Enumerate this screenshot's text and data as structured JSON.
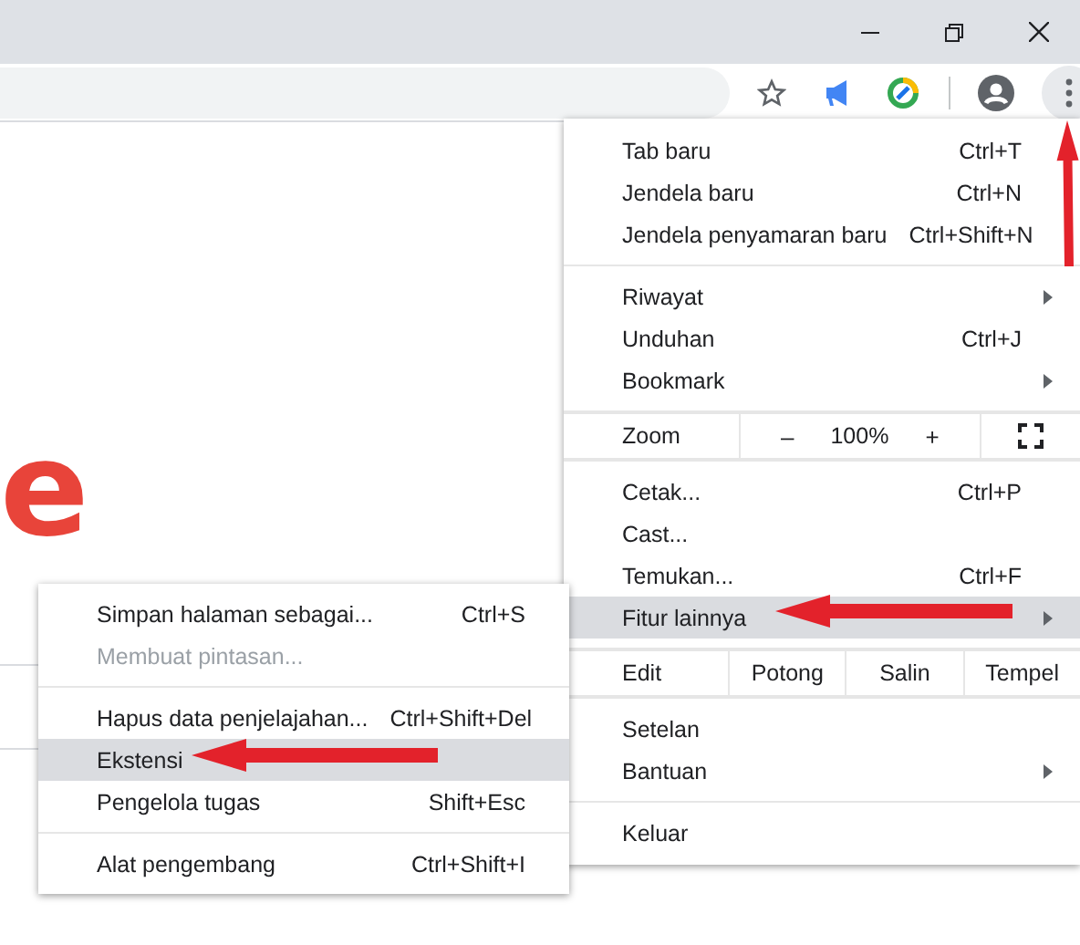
{
  "page": {
    "logo_fragment": "e"
  },
  "menu": {
    "sections": [
      [
        {
          "kind": "item",
          "label": "Tab baru",
          "shortcut": "Ctrl+T",
          "submenu": false,
          "selected": false
        },
        {
          "kind": "item",
          "label": "Jendela baru",
          "shortcut": "Ctrl+N",
          "submenu": false,
          "selected": false
        },
        {
          "kind": "item",
          "label": "Jendela penyamaran baru",
          "shortcut": "Ctrl+Shift+N",
          "submenu": false,
          "selected": false
        }
      ],
      [
        {
          "kind": "item",
          "label": "Riwayat",
          "submenu": true,
          "selected": false
        },
        {
          "kind": "item",
          "label": "Unduhan",
          "shortcut": "Ctrl+J",
          "submenu": false,
          "selected": false
        },
        {
          "kind": "item",
          "label": "Bookmark",
          "submenu": true,
          "selected": false
        }
      ],
      [
        {
          "kind": "zoom",
          "label": "Zoom",
          "minus": "–",
          "reading": "100%",
          "plus": "+"
        }
      ],
      [
        {
          "kind": "item",
          "label": "Cetak...",
          "shortcut": "Ctrl+P",
          "submenu": false,
          "selected": false
        },
        {
          "kind": "item",
          "label": "Cast...",
          "submenu": false,
          "selected": false
        },
        {
          "kind": "item",
          "label": "Temukan...",
          "shortcut": "Ctrl+F",
          "submenu": false,
          "selected": false
        },
        {
          "kind": "item",
          "label": "Fitur lainnya",
          "submenu": true,
          "selected": true
        }
      ],
      [
        {
          "kind": "edit",
          "label": "Edit",
          "actions": [
            "Potong",
            "Salin",
            "Tempel"
          ]
        }
      ],
      [
        {
          "kind": "item",
          "label": "Setelan",
          "submenu": false,
          "selected": false
        },
        {
          "kind": "item",
          "label": "Bantuan",
          "submenu": true,
          "selected": false
        }
      ],
      [
        {
          "kind": "item",
          "label": "Keluar",
          "submenu": false,
          "selected": false
        }
      ]
    ]
  },
  "submenu": {
    "sections": [
      [
        {
          "label": "Simpan halaman sebagai...",
          "shortcut": "Ctrl+S",
          "disabled": false,
          "selected": false
        },
        {
          "label": "Membuat pintasan...",
          "disabled": true,
          "selected": false
        }
      ],
      [
        {
          "label": "Hapus data penjelajahan...",
          "shortcut": "Ctrl+Shift+Del",
          "disabled": false,
          "selected": false
        },
        {
          "label": "Ekstensi",
          "disabled": false,
          "selected": true
        },
        {
          "label": "Pengelola tugas",
          "shortcut": "Shift+Esc",
          "disabled": false,
          "selected": false
        }
      ],
      [
        {
          "label": "Alat pengembang",
          "shortcut": "Ctrl+Shift+I",
          "disabled": false,
          "selected": false
        }
      ]
    ]
  }
}
